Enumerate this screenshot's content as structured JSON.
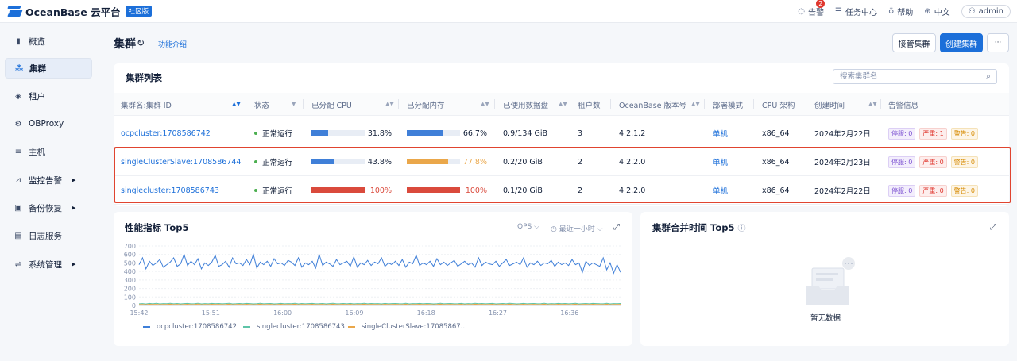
{
  "brand": {
    "name": "OceanBase 云平台",
    "edition_badge": "社区版"
  },
  "topbar": {
    "alerts": {
      "label": "告警",
      "count": "2"
    },
    "tasks": "任务中心",
    "help": "帮助",
    "language": "中文",
    "user": "admin"
  },
  "sidebar": {
    "items": [
      {
        "label": "概览",
        "icon": "bar-chart-icon"
      },
      {
        "label": "集群",
        "icon": "cluster-icon"
      },
      {
        "label": "租户",
        "icon": "tenant-icon"
      },
      {
        "label": "OBProxy",
        "icon": "proxy-icon"
      },
      {
        "label": "主机",
        "icon": "host-icon"
      },
      {
        "label": "监控告警",
        "icon": "monitor-icon"
      },
      {
        "label": "备份恢复",
        "icon": "backup-icon"
      },
      {
        "label": "日志服务",
        "icon": "log-icon"
      },
      {
        "label": "系统管理",
        "icon": "settings-icon"
      }
    ]
  },
  "page": {
    "title": "集群",
    "intro_link": "功能介绍",
    "takeover_button": "接管集群",
    "create_button": "创建集群",
    "more_button": "···"
  },
  "cluster_list": {
    "title": "集群列表",
    "search_placeholder": "搜索集群名",
    "columns": [
      "集群名:集群 ID",
      "状态",
      "已分配 CPU",
      "已分配内存",
      "已使用数据盘",
      "租户数",
      "OceanBase 版本号",
      "部署模式",
      "CPU 架构",
      "创建时间",
      "告警信息"
    ],
    "rows": [
      {
        "name": "ocpcluster:1708586742",
        "status": "正常运行",
        "cpu_pct": "31.8%",
        "cpu_value": 31.8,
        "mem_pct": "66.7%",
        "mem_value": 66.7,
        "disk": "0.9/134 GiB",
        "tenants": "3",
        "version": "4.2.1.2",
        "mode": "单机",
        "arch": "x86_64",
        "created": "2024年2月22日",
        "alerts": {
          "stop": "停服: 0",
          "critical": "严重: 1",
          "warning": "警告: 0"
        }
      },
      {
        "name": "singleClusterSlave:1708586744",
        "status": "正常运行",
        "cpu_pct": "43.8%",
        "cpu_value": 43.8,
        "mem_pct": "77.8%",
        "mem_value": 77.8,
        "disk": "0.2/20 GiB",
        "tenants": "2",
        "version": "4.2.2.0",
        "mode": "单机",
        "arch": "x86_64",
        "created": "2024年2月23日",
        "alerts": {
          "stop": "停服: 0",
          "critical": "严重: 0",
          "warning": "警告: 0"
        }
      },
      {
        "name": "singlecluster:1708586743",
        "status": "正常运行",
        "cpu_pct": "100%",
        "cpu_value": 100,
        "mem_pct": "100%",
        "mem_value": 100,
        "disk": "0.1/20 GiB",
        "tenants": "2",
        "version": "4.2.2.0",
        "mode": "单机",
        "arch": "x86_64",
        "created": "2024年2月22日",
        "alerts": {
          "stop": "停服: 0",
          "critical": "严重: 0",
          "warning": "警告: 0"
        }
      }
    ]
  },
  "perf": {
    "title": "性能指标 Top5",
    "metric_select": "QPS",
    "range_select": "最近一小时"
  },
  "merge": {
    "title": "集群合并时间 Top5",
    "empty_text": "暂无数据"
  },
  "colors": {
    "primary": "#1c6fd9",
    "normal_fill": "#3f7fd8",
    "warn_fill": "#eaa74a",
    "danger_fill": "#da4a3c",
    "highlight_border": "#e0442f"
  },
  "chart_data": {
    "type": "line",
    "title": "",
    "xlabel": "",
    "ylabel": "",
    "ylim": [
      0,
      700
    ],
    "yticks": [
      0,
      100,
      200,
      300,
      400,
      500,
      600,
      700
    ],
    "xticks": [
      "15:42",
      "15:51",
      "16:00",
      "16:09",
      "16:18",
      "16:27",
      "16:36"
    ],
    "legend_position": "bottom",
    "series": [
      {
        "name": "ocpcluster:1708586742",
        "color": "#3f7fd8",
        "values": [
          480,
          560,
          430,
          520,
          470,
          500,
          540,
          450,
          480,
          510,
          560,
          460,
          490,
          600,
          470,
          520,
          480,
          550,
          430,
          500,
          470,
          510,
          590,
          460,
          480,
          520,
          450,
          560,
          490,
          500,
          470,
          540,
          480,
          600,
          440,
          510,
          480,
          520,
          460,
          550,
          490,
          500,
          470,
          530,
          510,
          470,
          560,
          450,
          500,
          480,
          520,
          440,
          600,
          470,
          510,
          490,
          460,
          540,
          480,
          500,
          520,
          460,
          570,
          450,
          500,
          480,
          530,
          470,
          510,
          490,
          560,
          460,
          500,
          480,
          520,
          470,
          540,
          450,
          510,
          490,
          590,
          470,
          500,
          480,
          520,
          460,
          550,
          480,
          510,
          470,
          500,
          530,
          460,
          490,
          520,
          480,
          500,
          450,
          560,
          470,
          510,
          490,
          480,
          520,
          460,
          500,
          540,
          470,
          490,
          510,
          480,
          560,
          450,
          500,
          480,
          520,
          470,
          500,
          490,
          530,
          460,
          510,
          480,
          500,
          470,
          540,
          480,
          500,
          390,
          520,
          470,
          500,
          480,
          460,
          560,
          420,
          500,
          380,
          480,
          390
        ]
      },
      {
        "name": "singlecluster:1708586743",
        "color": "#5ec4a8",
        "values": [
          20,
          22,
          18,
          24,
          20,
          26,
          19,
          22,
          21,
          25,
          20,
          23,
          19,
          22,
          24,
          20,
          21,
          26,
          19,
          22,
          20,
          24,
          21,
          23,
          20,
          22,
          25,
          19,
          21,
          23,
          20,
          24,
          22,
          19,
          21,
          25,
          20,
          22,
          23,
          19,
          21,
          24,
          20,
          22,
          21,
          25,
          19,
          23,
          20,
          22,
          24,
          20,
          21,
          23,
          19,
          22,
          25,
          20,
          21,
          23,
          20,
          24,
          19,
          22,
          21,
          25,
          20,
          23,
          21,
          22,
          19,
          24,
          20,
          22,
          23,
          21,
          20,
          25,
          19,
          22,
          21,
          24,
          20,
          23,
          22,
          19,
          21,
          25,
          20,
          22,
          23,
          20,
          21,
          24,
          19,
          22,
          20,
          25,
          21,
          23,
          20,
          22,
          24,
          19,
          21,
          23,
          20,
          25,
          22,
          19,
          21,
          24,
          20,
          22,
          23,
          20,
          21,
          25,
          19,
          22,
          20,
          24,
          21,
          23,
          20,
          22,
          25,
          19,
          21,
          23,
          20,
          24,
          22,
          21,
          20,
          25,
          19,
          22,
          21,
          23
        ]
      },
      {
        "name": "singleClusterSlave:17085867...",
        "color": "#eaa74a",
        "values": [
          10,
          12,
          9,
          14,
          11,
          13,
          10,
          12,
          11,
          15,
          10,
          13,
          9,
          12,
          14,
          10,
          11,
          16,
          9,
          12,
          10,
          14,
          11,
          13,
          10,
          12,
          15,
          9,
          11,
          13,
          10,
          14,
          12,
          9,
          11,
          15,
          10,
          12,
          13,
          9,
          11,
          14,
          10,
          12,
          11,
          15,
          9,
          13,
          10,
          12,
          14,
          10,
          11,
          13,
          9,
          12,
          15,
          10,
          11,
          13,
          10,
          14,
          9,
          12,
          11,
          15,
          10,
          13,
          11,
          12,
          9,
          14,
          10,
          12,
          13,
          11,
          10,
          15,
          9,
          12,
          11,
          14,
          10,
          13,
          12,
          9,
          11,
          15,
          10,
          12,
          13,
          10,
          11,
          14,
          9,
          12,
          10,
          15,
          11,
          13,
          10,
          12,
          14,
          9,
          11,
          13,
          10,
          15,
          12,
          9,
          11,
          14,
          10,
          12,
          13,
          10,
          11,
          15,
          9,
          12,
          10,
          14,
          11,
          13,
          10,
          12,
          15,
          9,
          11,
          13,
          10,
          14,
          12,
          11,
          10,
          15,
          9,
          12,
          11,
          13
        ]
      }
    ]
  }
}
